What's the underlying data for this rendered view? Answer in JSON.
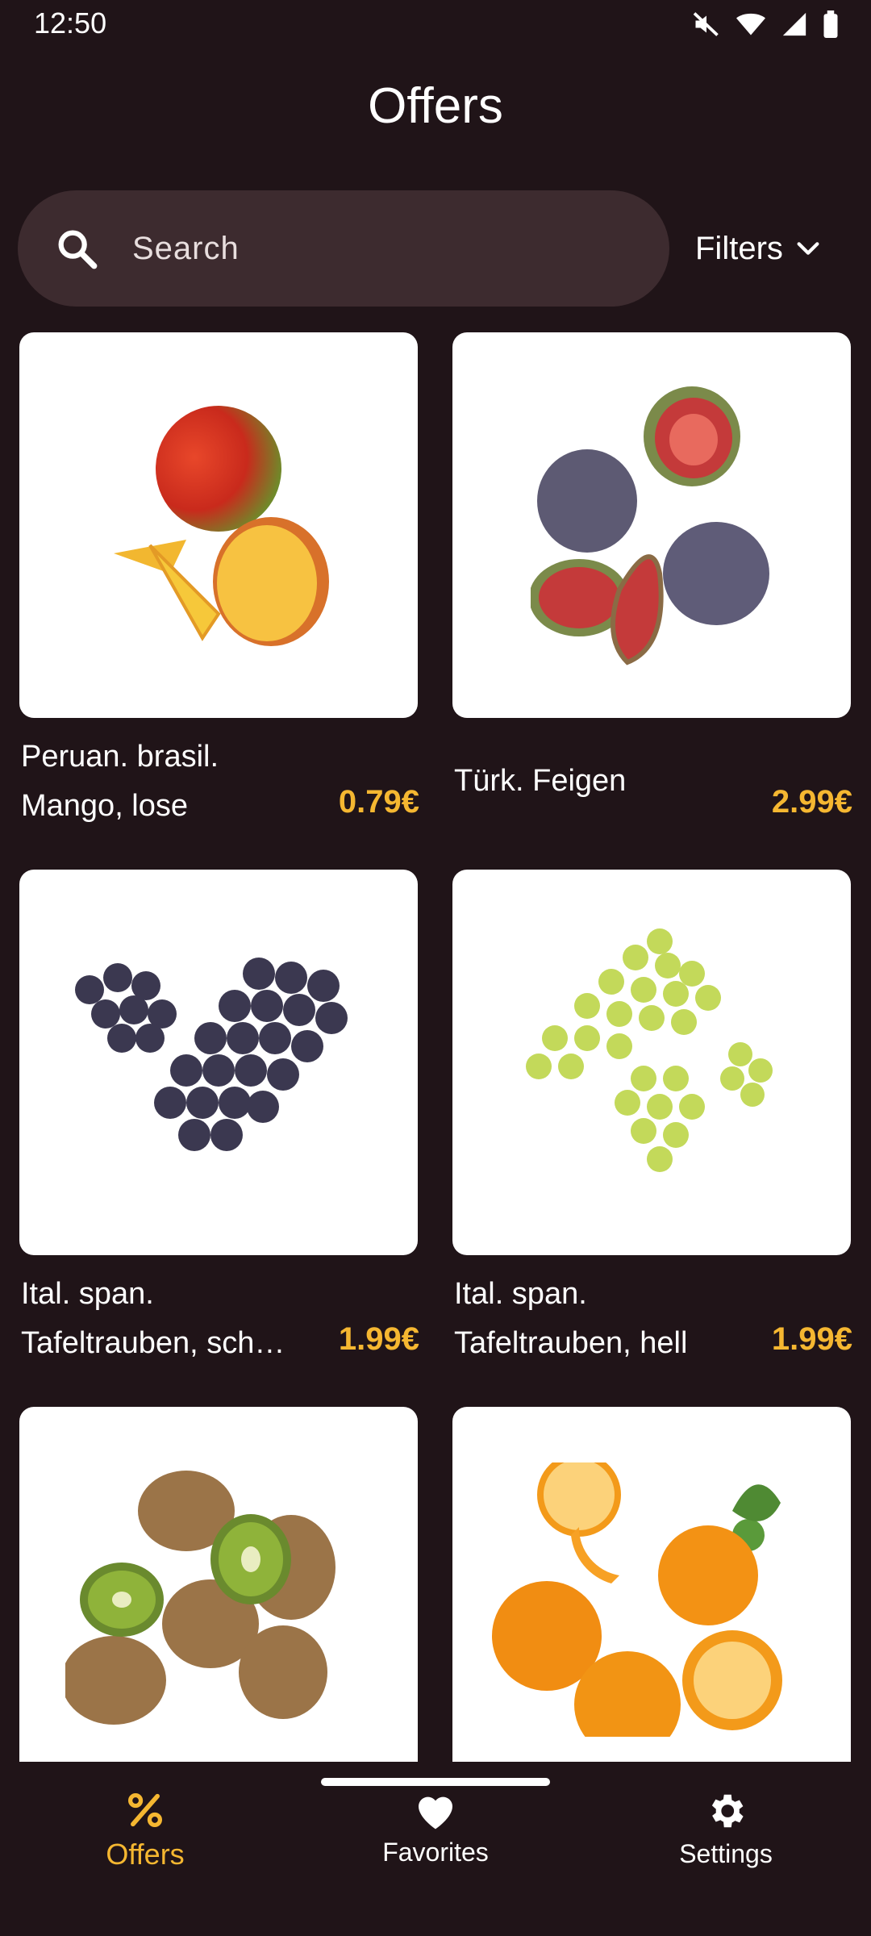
{
  "status": {
    "time": "12:50"
  },
  "header": {
    "title": "Offers"
  },
  "search": {
    "placeholder": "Search"
  },
  "filters": {
    "label": "Filters"
  },
  "products": [
    {
      "name_line1": "Peruan. brasil.",
      "name_line2": "Mango, lose",
      "price": "0.79€",
      "image": "mango"
    },
    {
      "name_line1": "Türk. Feigen",
      "name_line2": "",
      "price": "2.99€",
      "image": "figs"
    },
    {
      "name_line1": "Ital. span.",
      "name_line2": "Tafeltrauben, sch…",
      "price": "1.99€",
      "image": "dark-grapes"
    },
    {
      "name_line1": "Ital. span.",
      "name_line2": "Tafeltrauben, hell",
      "price": "1.99€",
      "image": "green-grapes"
    },
    {
      "name_line1": "",
      "name_line2": "",
      "price": "",
      "image": "kiwis"
    },
    {
      "name_line1": "",
      "name_line2": "",
      "price": "",
      "image": "oranges"
    }
  ],
  "nav": {
    "items": [
      {
        "label": "Offers",
        "icon": "percent-icon",
        "active": true
      },
      {
        "label": "Favorites",
        "icon": "heart-icon",
        "active": false
      },
      {
        "label": "Settings",
        "icon": "gear-icon",
        "active": false
      }
    ]
  },
  "colors": {
    "background": "#201418",
    "search_bg": "#3d2b2f",
    "accent": "#f5b731",
    "card": "#ffffff"
  }
}
